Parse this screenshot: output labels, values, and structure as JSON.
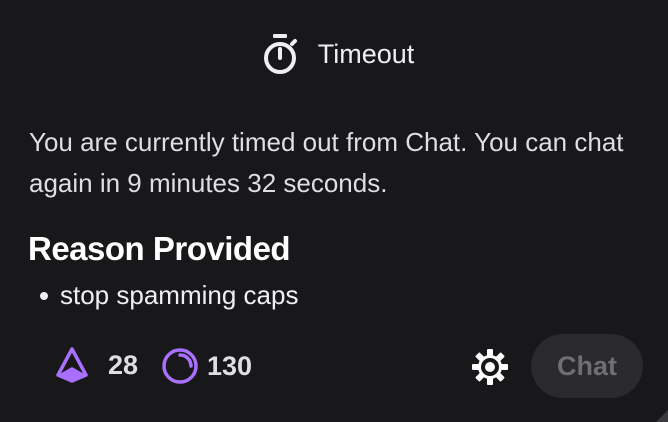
{
  "header": {
    "icon": "stopwatch-icon",
    "title": "Timeout"
  },
  "message": "You are currently timed out from Chat. You can chat again in 9 minutes 32 seconds.",
  "reason": {
    "heading": "Reason Provided",
    "items": [
      "stop spamming caps"
    ]
  },
  "footer": {
    "bits": {
      "icon": "bits-diamond-icon",
      "count": "28",
      "color": "#a970ff"
    },
    "channel_points": {
      "icon": "channel-points-icon",
      "count": "130",
      "color": "#a970ff"
    },
    "settings_icon": "gear-icon",
    "chat_button_label": "Chat"
  }
}
